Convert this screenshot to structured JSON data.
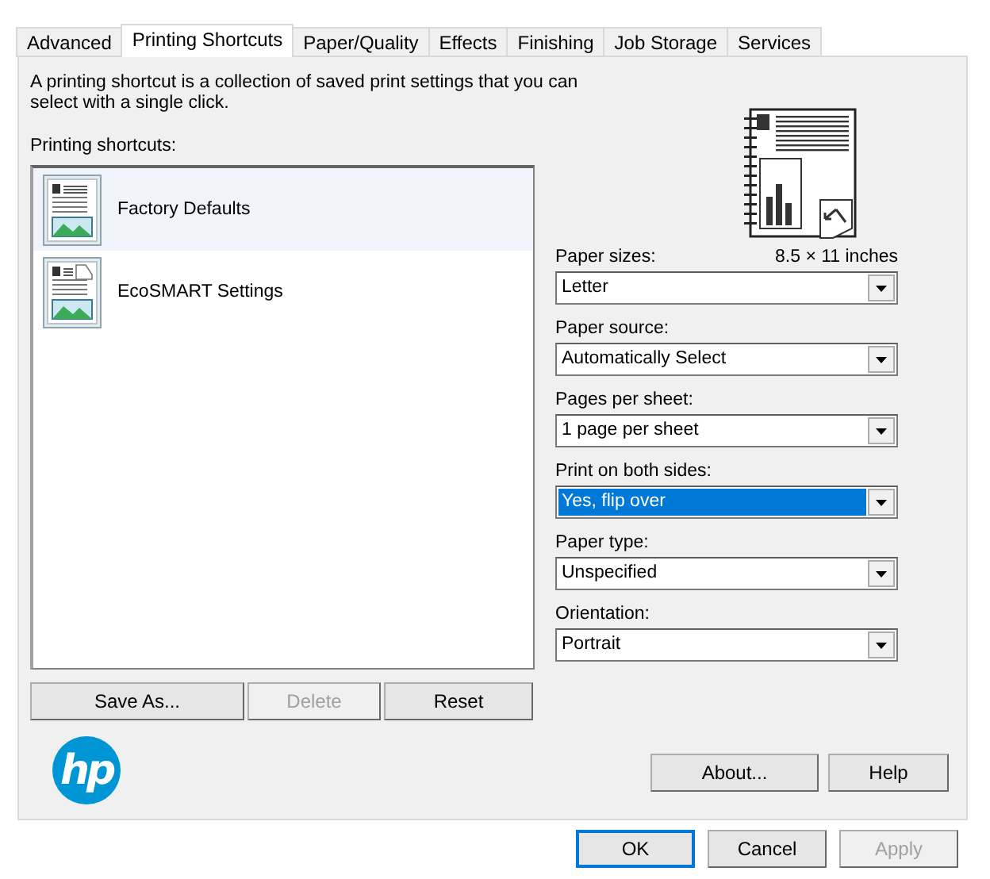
{
  "tabs": [
    {
      "label": "Advanced",
      "selected": false
    },
    {
      "label": "Printing Shortcuts",
      "selected": true
    },
    {
      "label": "Paper/Quality",
      "selected": false
    },
    {
      "label": "Effects",
      "selected": false
    },
    {
      "label": "Finishing",
      "selected": false
    },
    {
      "label": "Job Storage",
      "selected": false
    },
    {
      "label": "Services",
      "selected": false
    }
  ],
  "description": "A printing shortcut is a collection of saved print settings that you can select with a single click.",
  "shortcuts_label": "Printing shortcuts:",
  "shortcuts": [
    {
      "name": "Factory Defaults",
      "selected": true,
      "kind": "standard"
    },
    {
      "name": "EcoSMART Settings",
      "selected": false,
      "kind": "eco"
    }
  ],
  "shortcut_buttons": [
    {
      "label": "Save As...",
      "disabled": false
    },
    {
      "label": "Delete",
      "disabled": true
    },
    {
      "label": "Reset",
      "disabled": false
    }
  ],
  "logo": "hp",
  "paper_size_reading": "8.5 × 11 inches",
  "settings": [
    {
      "label": "Paper sizes:",
      "value": "Letter",
      "highlighted": false
    },
    {
      "label": "Paper source:",
      "value": "Automatically Select",
      "highlighted": false
    },
    {
      "label": "Pages per sheet:",
      "value": "1 page per sheet",
      "highlighted": false
    },
    {
      "label": "Print on both sides:",
      "value": "Yes, flip over",
      "highlighted": true
    },
    {
      "label": "Paper type:",
      "value": "Unspecified",
      "highlighted": false
    },
    {
      "label": "Orientation:",
      "value": "Portrait",
      "highlighted": false
    }
  ],
  "panel_buttons": [
    {
      "label": "About...",
      "disabled": false
    },
    {
      "label": "Help",
      "disabled": false
    }
  ],
  "dialog_buttons": [
    {
      "label": "OK",
      "disabled": false,
      "default": true
    },
    {
      "label": "Cancel",
      "disabled": false,
      "default": false
    },
    {
      "label": "Apply",
      "disabled": true,
      "default": false
    }
  ]
}
